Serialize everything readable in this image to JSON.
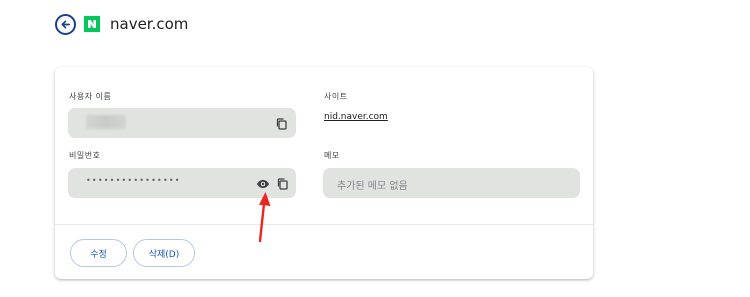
{
  "header": {
    "site_title": "naver.com"
  },
  "fields": {
    "username_label": "사용자 이름",
    "site_label": "사이트",
    "site_link": "nid.naver.com",
    "password_label": "비밀번호",
    "password_masked": "••••••••••••••••",
    "memo_label": "메모",
    "memo_placeholder": "추가된 메모 없음"
  },
  "actions": {
    "edit_label": "수정",
    "delete_label": "삭제(D)"
  },
  "icons": [
    "back-arrow-icon",
    "naver-logo-icon",
    "copy-icon",
    "eye-icon",
    "annotation-arrow"
  ],
  "colors": {
    "accent": "#1a56c4",
    "naver_green": "#03c75a",
    "annotation_red": "#e8281e"
  }
}
